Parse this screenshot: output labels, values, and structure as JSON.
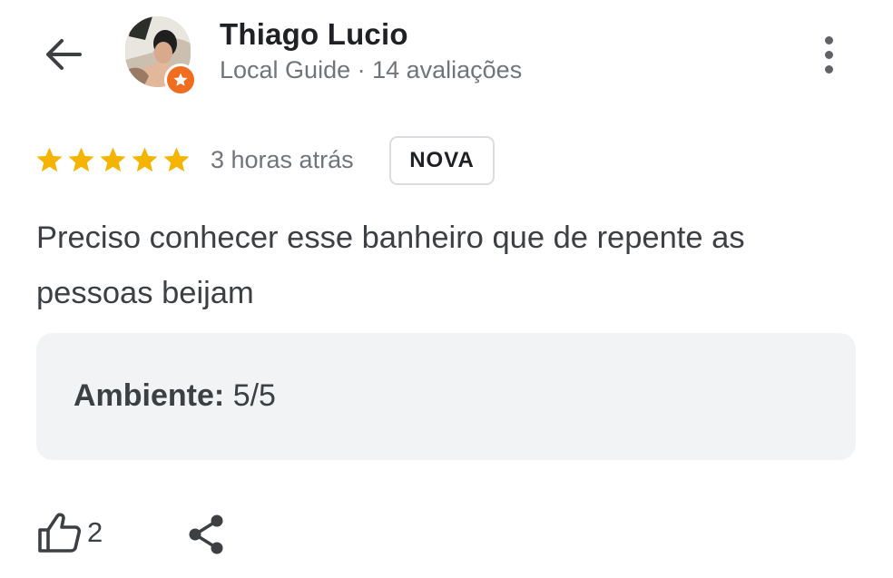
{
  "header": {
    "back_icon": "arrow-left-icon",
    "user_name": "Thiago Lucio",
    "user_meta": "Local Guide · 14 avaliações",
    "badge_icon": "local-guide-star-icon",
    "badge_color": "#f06d20",
    "more_icon": "more-vert-icon"
  },
  "review": {
    "rating": 5,
    "rating_max": 5,
    "star_color": "#f5b400",
    "time_ago": "3 horas atrás",
    "new_label": "NOVA",
    "text": "Preciso conhecer esse banheiro que de repente as pessoas beijam",
    "attributes": [
      {
        "label": "Ambiente:",
        "value": "5/5"
      }
    ]
  },
  "actions": {
    "like_icon": "thumb-up-icon",
    "like_count": "2",
    "share_icon": "share-icon"
  }
}
